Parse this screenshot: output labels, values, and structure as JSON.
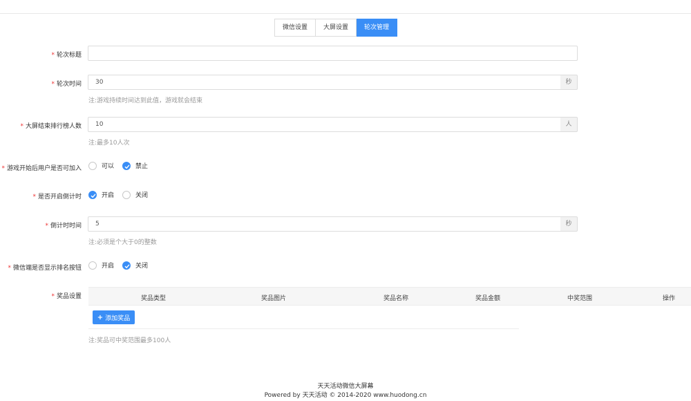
{
  "tabs": [
    {
      "label": "微信设置",
      "active": false
    },
    {
      "label": "大屏设置",
      "active": false
    },
    {
      "label": "轮次管理",
      "active": true
    }
  ],
  "form": {
    "round_title": {
      "label": "轮次标题",
      "value": ""
    },
    "round_time": {
      "label": "轮次时间",
      "value": "30",
      "unit": "秒",
      "note": "注:游戏持续时间达到此值，游戏就会结束"
    },
    "rank_count": {
      "label": "大屏结束排行榜人数",
      "value": "10",
      "unit": "人",
      "note": "注:最多10人次"
    },
    "join_after_start": {
      "label": "游戏开始后用户是否可加入",
      "options": [
        "可以",
        "禁止"
      ],
      "selected": "禁止"
    },
    "countdown_enabled": {
      "label": "是否开启倒计时",
      "options": [
        "开启",
        "关闭"
      ],
      "selected": "开启"
    },
    "countdown_time": {
      "label": "倒计时时间",
      "value": "5",
      "unit": "秒",
      "note": "注:必须是个大于0的整数"
    },
    "wechat_rank_button": {
      "label": "微信端是否显示排名按钮",
      "options": [
        "开启",
        "关闭"
      ],
      "selected": "关闭"
    },
    "prizes": {
      "label": "奖品设置",
      "columns": [
        "奖品类型",
        "奖品图片",
        "奖品名称",
        "奖品金额",
        "中奖范围",
        "操作"
      ],
      "add_button": "添加奖品",
      "note": "注:奖品可中奖范围最多100人"
    }
  },
  "footer": {
    "line1": "天天活动微信大屏幕",
    "line2": "Powered by 天天活动 © 2014-2020 www.huodong.cn"
  },
  "colors": {
    "accent": "#3a8ef6",
    "required": "#e33333"
  }
}
